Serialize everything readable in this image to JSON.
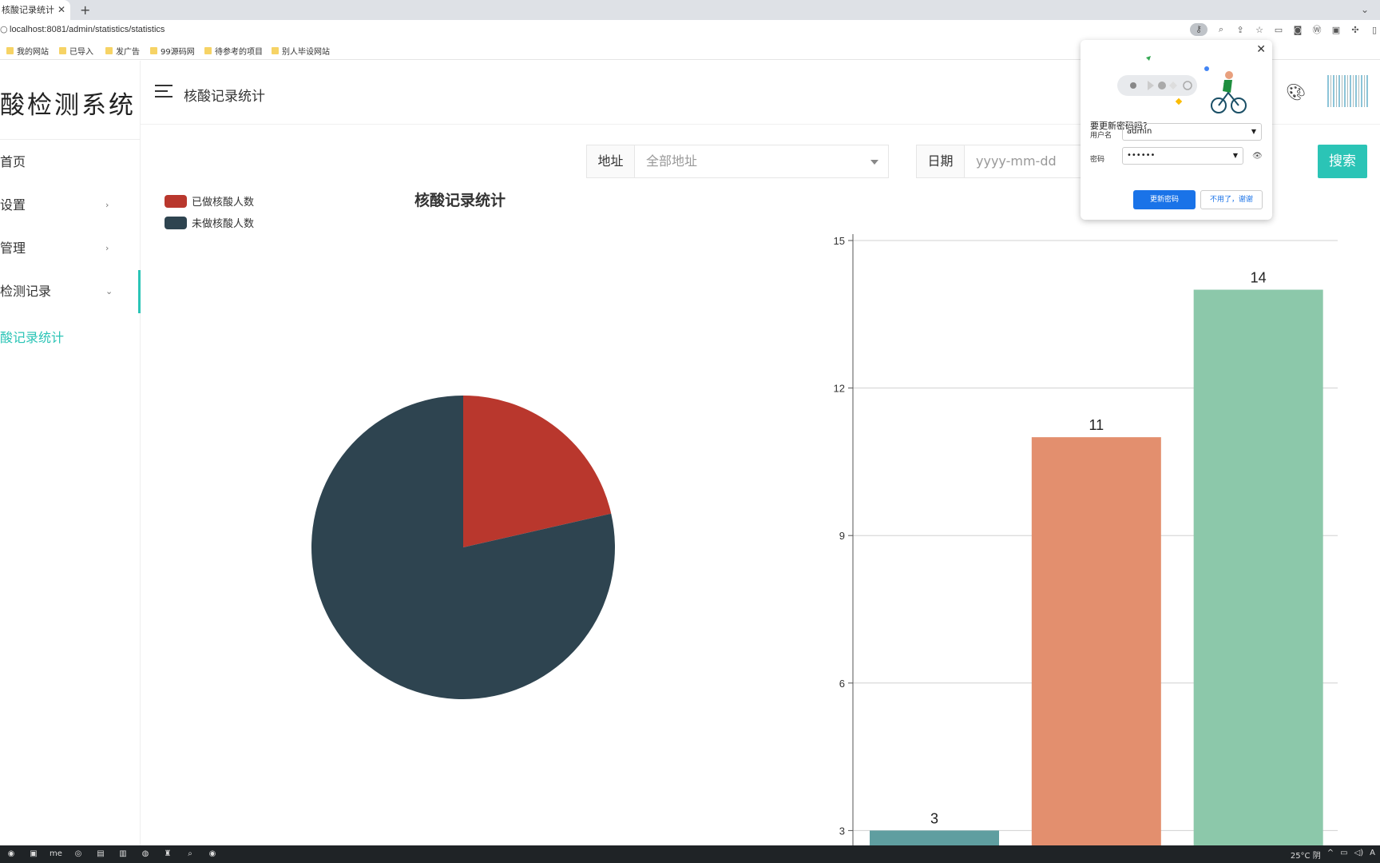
{
  "browser": {
    "tab_title": "核酸记录统计",
    "tab_close": "✕",
    "new_tab": "+",
    "tab_menu": "⌄",
    "url": "localhost:8081/admin/statistics/statistics",
    "bookmarks": [
      "我的网站",
      "已导入",
      "发广告",
      "99源码网",
      "待参考的项目",
      "别人毕设网站"
    ]
  },
  "sidebar": {
    "logo": "酸检测系统",
    "items": [
      {
        "label": "首页",
        "arrow": ""
      },
      {
        "label": "设置",
        "arrow": "›"
      },
      {
        "label": "管理",
        "arrow": "›"
      },
      {
        "label": "检测记录",
        "arrow": "⌄"
      }
    ],
    "submenu_active": "酸记录统计"
  },
  "header": {
    "title": "核酸记录统计"
  },
  "filters": {
    "address_label": "地址",
    "address_value": "全部地址",
    "date_label": "日期",
    "date_placeholder": "yyyy-mm-dd",
    "search_label": "搜索"
  },
  "colors": {
    "accent": "#2bc4b6",
    "done": "#b9372d",
    "not_done": "#2e4450",
    "bar1": "#5f9ea0",
    "bar2": "#e38f6e",
    "bar3": "#8cc8aa"
  },
  "chart_data": [
    {
      "type": "pie",
      "title": "核酸记录统计",
      "legend": [
        "已做核酸人数",
        "未做核酸人数"
      ],
      "legend_position": "top-left",
      "values": [
        3,
        11
      ]
    },
    {
      "type": "bar",
      "categories": [
        "",
        "",
        ""
      ],
      "values": [
        3,
        11,
        14
      ],
      "ylim": [
        0,
        15
      ],
      "yticks": [
        3,
        6,
        9,
        12,
        15
      ],
      "grid": true
    }
  ],
  "password_popup": {
    "question": "要更新密码吗?",
    "username_label": "用户名",
    "username_value": "admin",
    "password_label": "密码",
    "password_value": "••••••",
    "update_btn": "更新密码",
    "decline_btn": "不用了，谢谢",
    "close": "✕"
  },
  "taskbar": {
    "weather": "25°C 阴",
    "ime": "A"
  }
}
